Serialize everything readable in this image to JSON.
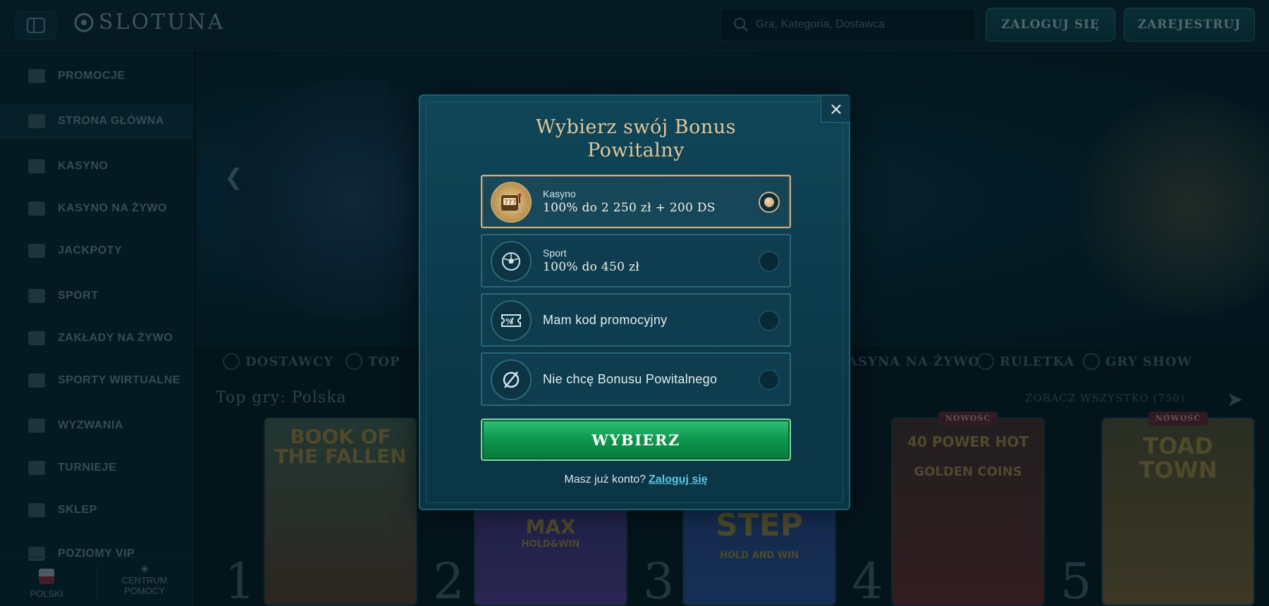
{
  "header": {
    "logo_text": "SLOTUNA",
    "search_placeholder": "Gra, Kategoria, Dostawca",
    "login_label": "ZALOGUJ SIĘ",
    "register_label": "ZAREJESTRUJ"
  },
  "sidebar": {
    "items": [
      {
        "label": "PROMOCJE",
        "icon": "chest-icon"
      },
      {
        "label": "STRONA GŁÓWNA",
        "icon": "castle-icon",
        "active": true
      },
      {
        "label": "KASYNO",
        "icon": "slot-machine-icon"
      },
      {
        "label": "KASYNO NA ŻYWO",
        "icon": "cards-icon"
      },
      {
        "label": "JACKPOTY",
        "icon": "clover-icon"
      },
      {
        "label": "SPORT",
        "icon": "ball-icon"
      },
      {
        "label": "ZAKŁADY NA ŻYWO",
        "icon": "live-icon"
      },
      {
        "label": "SPORTY WIRTUALNE",
        "icon": "monitor-icon"
      },
      {
        "label": "WYZWANIA",
        "icon": "target-icon"
      },
      {
        "label": "TURNIEJE",
        "icon": "trophy-icon"
      },
      {
        "label": "SKLEP",
        "icon": "shop-icon"
      },
      {
        "label": "POZIOMY VIP",
        "icon": "diamond-icon"
      }
    ],
    "language": "POLSKI",
    "help_center": "CENTRUM POMOCY"
  },
  "categories": [
    {
      "label": "DOSTAWCY"
    },
    {
      "label": "TOP"
    },
    {
      "label": "ASYNA NA ŻYWO"
    },
    {
      "label": "RULETKA"
    },
    {
      "label": "GRY SHOW"
    }
  ],
  "top_games": {
    "title": "Top gry: Polska",
    "see_all": "ZOBACZ WSZYSTKO (750)",
    "games": [
      {
        "rank": "1",
        "title": "BOOK OF THE FALLEN",
        "badge": ""
      },
      {
        "rank": "2",
        "title": "MAX",
        "subtitle": "HOLD&WIN",
        "badge": ""
      },
      {
        "rank": "3",
        "title": "STEP",
        "subtitle": "HOLD AND WIN",
        "badge": ""
      },
      {
        "rank": "4",
        "title": "40 POWER HOT",
        "subtitle": "GOLDEN COINS",
        "badge": "NOWOŚĆ"
      },
      {
        "rank": "5",
        "title": "TOAD TOWN",
        "badge": "NOWOŚĆ"
      }
    ]
  },
  "modal": {
    "title_line1": "Wybierz swój Bonus",
    "title_line2": "Powitalny",
    "options": [
      {
        "label": "Kasyno",
        "value": "100% do 2 250 zł + 200 DS",
        "selected": true,
        "icon": "slot-machine-icon"
      },
      {
        "label": "Sport",
        "value": "100% do 450 zł",
        "selected": false,
        "icon": "soccer-ball-icon"
      },
      {
        "label": "",
        "value": "Mam kod promocyjny",
        "selected": false,
        "icon": "promo-ticket-icon"
      },
      {
        "label": "",
        "value": "Nie chcę Bonusu Powitalnego",
        "selected": false,
        "icon": "no-bonus-icon"
      }
    ],
    "submit_label": "WYBIERZ",
    "login_prompt": "Masz już konto?",
    "login_link": "Zaloguj się"
  },
  "colors": {
    "accent_gold": "#e3c697",
    "submit_green": "#0e9a4f",
    "link_blue": "#5cc7e8"
  }
}
